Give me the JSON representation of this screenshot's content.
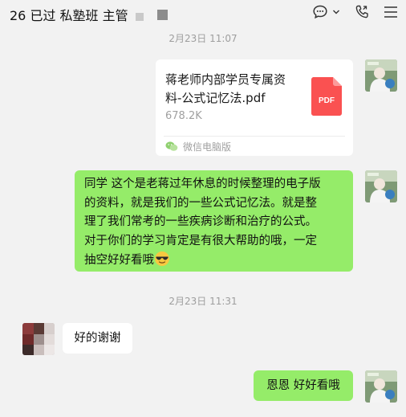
{
  "header": {
    "title": "26 已过 私塾班 主管",
    "icons": [
      "chat-bubble-icon",
      "chevron-down-icon",
      "phone-icon",
      "menu-icon"
    ]
  },
  "messages": [
    {
      "timestamp": "2月23日 11:07",
      "sender": "self",
      "type": "file",
      "file_name": "蒋老师内部学员专属资料-公式记忆法.pdf",
      "file_size": "678.2K",
      "file_icon_label": "PDF",
      "source": "微信电脑版"
    },
    {
      "sender": "self",
      "type": "text",
      "lines": [
        "同学 这个是老蒋过年休息的时候整理的电子版",
        "的资料，就是我们的一些公式记忆法。就是整",
        "理了我们常考的一些疾病诊断和治疗的公式。",
        "对于你们的学习肯定是有很大帮助的哦，一定",
        "抽空好好看哦"
      ],
      "emoji": "cool-sunglasses-emoji"
    },
    {
      "timestamp": "2月23日 11:31",
      "sender": "other",
      "type": "text",
      "text": "好的谢谢"
    },
    {
      "sender": "self",
      "type": "text",
      "text": "恩恩 好好看哦"
    }
  ],
  "colors": {
    "background": "#f2f2f2",
    "self_bubble": "#95ec69",
    "other_bubble": "#ffffff",
    "pdf_icon": "#fa5151",
    "timestamp": "#9e9e9e"
  }
}
